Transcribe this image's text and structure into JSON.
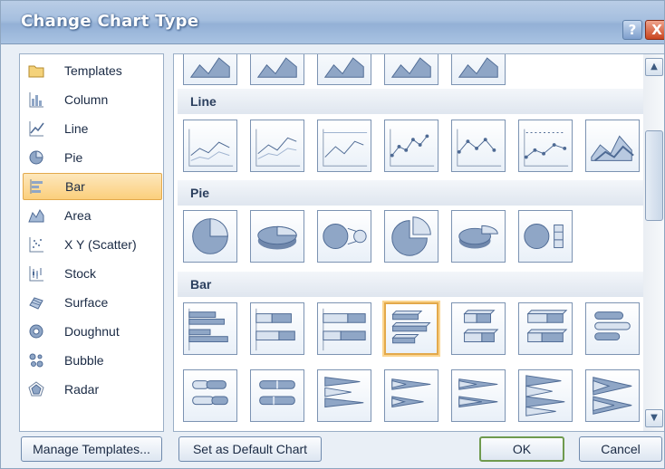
{
  "dialog": {
    "title": "Change Chart Type",
    "help_label": "?",
    "close_label": "X"
  },
  "categories": [
    {
      "label": "Templates",
      "icon": "folder-icon",
      "selected": false
    },
    {
      "label": "Column",
      "icon": "column-chart-icon",
      "selected": false
    },
    {
      "label": "Line",
      "icon": "line-chart-icon",
      "selected": false
    },
    {
      "label": "Pie",
      "icon": "pie-chart-icon",
      "selected": false
    },
    {
      "label": "Bar",
      "icon": "bar-chart-icon",
      "selected": true
    },
    {
      "label": "Area",
      "icon": "area-chart-icon",
      "selected": false
    },
    {
      "label": "X Y (Scatter)",
      "icon": "scatter-chart-icon",
      "selected": false
    },
    {
      "label": "Stock",
      "icon": "stock-chart-icon",
      "selected": false
    },
    {
      "label": "Surface",
      "icon": "surface-chart-icon",
      "selected": false
    },
    {
      "label": "Doughnut",
      "icon": "doughnut-chart-icon",
      "selected": false
    },
    {
      "label": "Bubble",
      "icon": "bubble-chart-icon",
      "selected": false
    },
    {
      "label": "Radar",
      "icon": "radar-chart-icon",
      "selected": false
    }
  ],
  "sections": {
    "line": "Line",
    "pie": "Pie",
    "bar": "Bar"
  },
  "buttons": {
    "manage": "Manage Templates...",
    "default": "Set as Default Chart",
    "ok": "OK",
    "cancel": "Cancel"
  },
  "scrollbar": {
    "up": "▲",
    "down": "▼"
  },
  "colors": {
    "accent": "#e3a94b",
    "chart_fill": "#7f9bc4",
    "chart_line": "#4e6a94",
    "titlebar": "#a6bfdf"
  }
}
